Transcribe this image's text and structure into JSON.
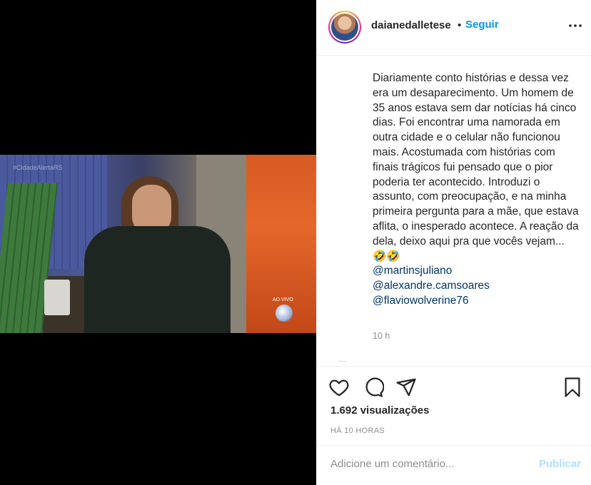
{
  "media": {
    "overlay_tag": "#CidadeAlertaRS",
    "live_label": "AO VIVO"
  },
  "header": {
    "username": "daianedalletese",
    "separator": "•",
    "follow_label": "Seguir",
    "more_icon": "more-options-icon"
  },
  "caption": {
    "text": "Diariamente conto histórias e dessa vez era um desaparecimento. Um homem de 35 anos estava sem dar notícias há cinco dias. Foi encontrar uma namorada em outra cidade e o celular não funcionou mais. Acostumada com histórias com finais trágicos fui pensado que o pior poderia ter acontecido. Introduzi o assunto, com preocupação, e na minha primeira pergunta para a mãe, que estava aflita, o inesperado acontece. A reação da dela, deixo aqui pra que vocês vejam... 🤣🤣",
    "mentions": [
      "@martinsjuliano",
      "@alexandre.camsoares",
      "@flaviowolverine76"
    ],
    "time": "10 h"
  },
  "actions": {
    "icons": [
      "heart-icon",
      "comment-icon",
      "share-icon",
      "bookmark-icon"
    ],
    "views": "1.692 visualizações",
    "posted_ago": "HÁ 10 HORAS"
  },
  "comment": {
    "placeholder": "Adicione um comentário...",
    "publish_label": "Publicar"
  },
  "colors": {
    "link_blue": "#0095f6",
    "mention_blue": "#00376b",
    "publish_disabled": "#b2dffc",
    "muted": "#8e8e8e"
  }
}
